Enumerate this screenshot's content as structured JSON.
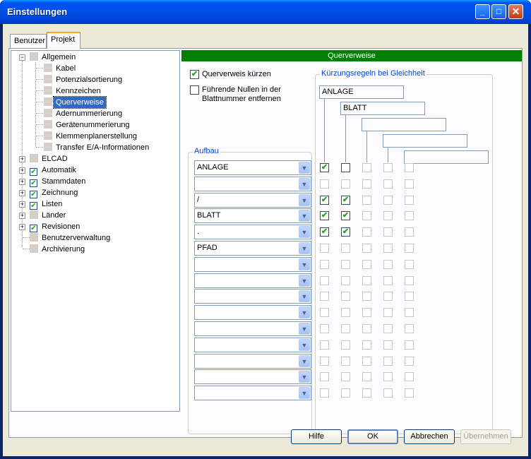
{
  "window": {
    "title": "Einstellungen",
    "minimize": "_",
    "maximize": "□",
    "close": "✕"
  },
  "tabs": [
    {
      "label": "Benutzer"
    },
    {
      "label": "Projekt"
    }
  ],
  "tree": {
    "allgemein": "Allgemein",
    "children": [
      "Kabel",
      "Potenzialsortierung",
      "Kennzeichen",
      "Querverweise",
      "Adernummerierung",
      "Gerätenummerierung",
      "Klemmenplanerstellung",
      "Transfer E/A-Informationen"
    ],
    "elcad": "ELCAD",
    "checked_nodes": [
      "Automatik",
      "Stammdaten",
      "Zeichnung",
      "Listen",
      "Länder",
      "Revisionen"
    ],
    "benutzerverwaltung": "Benutzerverwaltung",
    "archivierung": "Archivierung"
  },
  "panel": {
    "header": "Querverweise",
    "querverweis_kuerzen": "Querverweis kürzen",
    "nullen_line1": "Führende Nullen in der",
    "nullen_line2": "Blattnummer entfernen",
    "aufbau_title": "Aufbau",
    "kuerzung_title": "Kürzungsregeln bei Gleichheit",
    "rule1": "ANLAGE",
    "rule2": "BLATT",
    "aufbau_rows": [
      "ANLAGE",
      "",
      "/",
      "BLATT",
      ".",
      "PFAD",
      "",
      "",
      "",
      "",
      "",
      "",
      "",
      "",
      ""
    ]
  },
  "buttons": {
    "hilfe": "Hilfe",
    "ok": "OK",
    "abbrechen": "Abbrechen",
    "uebernehmen": "Übernehmen"
  },
  "icons": {
    "checkmark": "✔",
    "dropdown": "▼",
    "collapse": "−",
    "expand": "+"
  }
}
